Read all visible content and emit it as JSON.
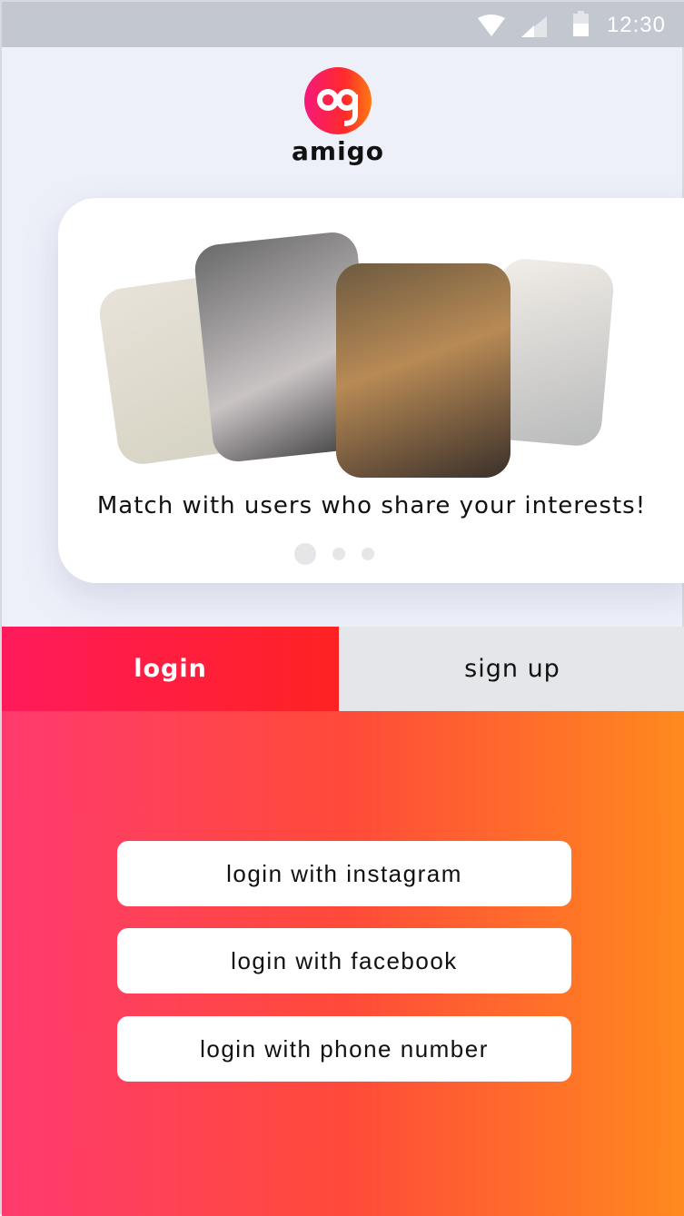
{
  "status_bar": {
    "time": "12:30"
  },
  "brand": {
    "name": "amigo",
    "logo_letters": "ag"
  },
  "carousel": {
    "caption": "Match with users who share your interests!",
    "page_count": 3,
    "active_page": 1
  },
  "tabs": {
    "login": "login",
    "signup": "sign up"
  },
  "buttons": {
    "instagram": "login with instagram",
    "facebook": "login with facebook",
    "phone": "login with phone number"
  }
}
